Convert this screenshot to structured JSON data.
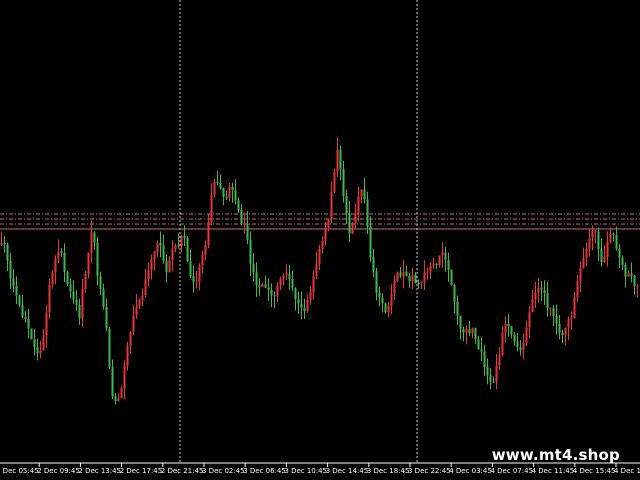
{
  "watermark": "www.mt4.shop",
  "colors": {
    "background": "#000000",
    "bull_candle": "#e8343a",
    "bear_candle": "#3fb94a",
    "separator": "#c8c8c8",
    "level_lines": "#c0706a",
    "axis_text": "#ffffff"
  },
  "chart_data": {
    "type": "candlestick",
    "grid": false,
    "x_tick_labels": [
      "2 Dec 05:45",
      "2 Dec 09:45",
      "2 Dec 13:45",
      "2 Dec 17:45",
      "2 Dec 21:45",
      "3 Dec 02:45",
      "3 Dec 06:45",
      "3 Dec 10:45",
      "3 Dec 14:45",
      "3 Dec 18:45",
      "3 Dec 22:45",
      "4 Dec 03:45",
      "4 Dec 07:45",
      "4 Dec 11:45",
      "4 Dec 15:45",
      "4 Dec 19:45"
    ],
    "day_separators_after_tick": [
      "2 Dec 21:45",
      "3 Dec 22:45"
    ],
    "horizontal_level_count": 4,
    "price_path": [
      72,
      70,
      60,
      52,
      48,
      44,
      38,
      33,
      30,
      30,
      38,
      56,
      64,
      70,
      66,
      58,
      54,
      48,
      44,
      60,
      68,
      80,
      60,
      50,
      40,
      18,
      8,
      12,
      20,
      32,
      42,
      48,
      50,
      56,
      62,
      68,
      74,
      66,
      62,
      70,
      70,
      74,
      76,
      60,
      56,
      60,
      66,
      72,
      92,
      100,
      96,
      90,
      94,
      96,
      88,
      82,
      80,
      66,
      62,
      54,
      58,
      54,
      50,
      52,
      58,
      62,
      60,
      54,
      50,
      46,
      48,
      54,
      60,
      70,
      76,
      82,
      96,
      110,
      100,
      86,
      76,
      84,
      92,
      96,
      80,
      64,
      54,
      48,
      46,
      48,
      56,
      60,
      62,
      58,
      60,
      58,
      56,
      60,
      62,
      64,
      66,
      72,
      66,
      58,
      48,
      40,
      38,
      36,
      38,
      34,
      30,
      22,
      18,
      16,
      26,
      36,
      40,
      38,
      32,
      30,
      34,
      44,
      50,
      54,
      54,
      50,
      46,
      42,
      38,
      36,
      40,
      44,
      56,
      62,
      68,
      76,
      80,
      72,
      64,
      72,
      76,
      72,
      66,
      60,
      62,
      56,
      54
    ]
  }
}
